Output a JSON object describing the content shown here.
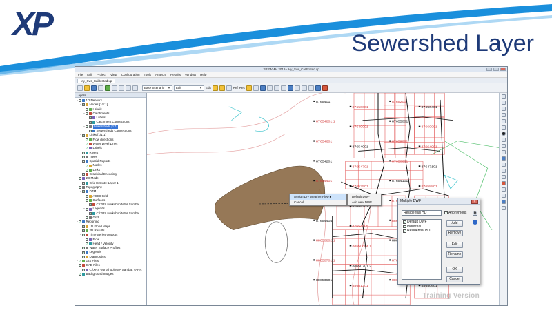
{
  "slide": {
    "logo": "XP",
    "title": "Sewershed Layer",
    "colors": {
      "brand": "#1e3a78",
      "swoosh_blue": "#1a8fdc"
    }
  },
  "window": {
    "title": "XPSWMM 2019 - My_Swr_Calibrated.xp",
    "document_tab": "My_Swr_Calibrated.xp"
  },
  "menu": [
    "File",
    "Edit",
    "Project",
    "View",
    "Configuration",
    "Tools",
    "Analyze",
    "Results",
    "Window",
    "Help"
  ],
  "toolbar": {
    "scenario_combo": "Base Scenario",
    "edit_combo": "Edit",
    "edit_label": "Edit",
    "ref_label": "Ref",
    "res_label": "Res"
  },
  "layers_panel": {
    "header": "Layers",
    "items": [
      {
        "label": "1D Network",
        "level": 0,
        "expanded": true,
        "checked": true,
        "icon": "network-icon"
      },
      {
        "label": "Nodes [1/1:1]",
        "level": 1,
        "expanded": true,
        "checked": true,
        "icon": "node-icon"
      },
      {
        "label": "Labels",
        "level": 2,
        "checked": true,
        "icon": "label-icon"
      },
      {
        "label": "Catchments",
        "level": 2,
        "expanded": true,
        "checked": true,
        "icon": "catchment-icon"
      },
      {
        "label": "Labels",
        "level": 3,
        "checked": true,
        "icon": "label-icon"
      },
      {
        "label": "Catchment Connections",
        "level": 3,
        "checked": true,
        "icon": "connection-icon"
      },
      {
        "label": "Sewersheds [1:1]",
        "level": 2,
        "expanded": true,
        "checked": true,
        "icon": "sewershed-icon",
        "selected": true
      },
      {
        "label": "Sewersheds Connections",
        "level": 3,
        "checked": true,
        "icon": "connection-icon"
      },
      {
        "label": "Links [1/1:1]",
        "level": 1,
        "expanded": true,
        "checked": true,
        "icon": "link-icon"
      },
      {
        "label": "Flow directions",
        "level": 2,
        "checked": true,
        "icon": "arrow-icon"
      },
      {
        "label": "Water Level Lines",
        "level": 2,
        "checked": true,
        "icon": "line-icon"
      },
      {
        "label": "Labels",
        "level": 2,
        "checked": true,
        "icon": "label-icon"
      },
      {
        "label": "Rivers",
        "level": 1,
        "checked": true,
        "icon": "river-icon"
      },
      {
        "label": "Trees",
        "level": 1,
        "checked": true,
        "icon": "tree-icon"
      },
      {
        "label": "Spatial Reports",
        "level": 1,
        "expanded": true,
        "checked": true,
        "icon": "report-icon"
      },
      {
        "label": "Nodes",
        "level": 2,
        "checked": true,
        "icon": "node-icon"
      },
      {
        "label": "Links",
        "level": 2,
        "checked": true,
        "icon": "link-icon"
      },
      {
        "label": "Graphical Encoding",
        "level": 1,
        "checked": true,
        "icon": "encoding-icon"
      },
      {
        "label": "2D Model",
        "level": 0,
        "expanded": true,
        "checked": true,
        "icon": "model-icon"
      },
      {
        "label": "Grid Extents: Layer 1",
        "level": 1,
        "checked": true,
        "icon": "grid-icon"
      },
      {
        "label": "Topography",
        "level": 0,
        "expanded": true,
        "checked": true,
        "icon": "topo-icon"
      },
      {
        "label": "DTM",
        "level": 1,
        "expanded": true,
        "checked": true,
        "icon": "dtm-icon"
      },
      {
        "label": "ASCII Grid",
        "level": 2,
        "checked": true,
        "icon": "grid-icon"
      },
      {
        "label": "Surfaces",
        "level": 2,
        "expanded": true,
        "checked": true,
        "icon": "surface-icon"
      },
      {
        "label": "C:\\XPS workshop\\MSA Samba\\",
        "level": 3,
        "checked": true,
        "icon": "file-icon"
      },
      {
        "label": "Legends",
        "level": 2,
        "expanded": true,
        "checked": true,
        "icon": "legend-icon"
      },
      {
        "label": "C:\\XPS workshop\\MSA Samba\\",
        "level": 3,
        "checked": true,
        "icon": "file-icon"
      },
      {
        "label": "Grid",
        "level": 2,
        "checked": true,
        "icon": "grid-icon"
      },
      {
        "label": "Reporting",
        "level": 0,
        "expanded": true,
        "checked": true,
        "icon": "report-icon"
      },
      {
        "label": "1D Flood Maps",
        "level": 1,
        "checked": true,
        "icon": "map-icon"
      },
      {
        "label": "2D Results",
        "level": 1,
        "checked": true,
        "icon": "result-icon"
      },
      {
        "label": "Time Series Outputs",
        "level": 1,
        "expanded": true,
        "checked": true,
        "icon": "timeseries-icon"
      },
      {
        "label": "Flow",
        "level": 2,
        "checked": true,
        "icon": "flow-icon"
      },
      {
        "label": "Head / Velocity",
        "level": 2,
        "checked": true,
        "icon": "velocity-icon"
      },
      {
        "label": "Water Surface Profiles",
        "level": 1,
        "checked": true,
        "icon": "profile-icon"
      },
      {
        "label": "Legends",
        "level": 1,
        "checked": true,
        "icon": "legend-icon"
      },
      {
        "label": "Diagnostics",
        "level": 1,
        "checked": true,
        "icon": "diagnostic-icon"
      },
      {
        "label": "GIS Files",
        "level": 0,
        "expanded": true,
        "checked": true,
        "icon": "gis-icon"
      },
      {
        "label": "CAD Files",
        "level": 0,
        "expanded": true,
        "checked": true,
        "icon": "cad-icon"
      },
      {
        "label": "C:\\XPS workshop\\MSA Samba\\ YARR",
        "level": 1,
        "checked": true,
        "icon": "file-icon"
      },
      {
        "label": "Background Images",
        "level": 0,
        "checked": true,
        "icon": "image-icon"
      }
    ]
  },
  "map": {
    "node_labels": [
      "8765401",
      "87650001",
      "8765200",
      "87650401",
      "87654801.1",
      "87640001",
      "87655001",
      "87660001",
      "87654601",
      "87654001",
      "87659001",
      "87664001",
      "87654201",
      "87654701",
      "87650601",
      "87647101",
      "87654401",
      "87653501",
      "87654101",
      "87658801",
      "87654103",
      "87654301",
      "87655102",
      "87651301",
      "87654404",
      "87654505",
      "88651001.1",
      "88651101",
      "88650802.1",
      "88650804.1",
      "88650801.1",
      "87650901.2",
      "88650701.1",
      "88650701.2",
      "87658701.2",
      "88653401",
      "88653601",
      "88651201",
      "88650201.1",
      "88650601"
    ]
  },
  "context_menu": {
    "items": [
      "Assign Dry Weather Flow ▸",
      "Cancel"
    ],
    "submenu": [
      "Default DWF",
      "Add new DWF..."
    ]
  },
  "dialog": {
    "title": "Multiple DWF",
    "name_value": "Residential HD",
    "anonymous_label": "Anonymous",
    "anonymous_checked": true,
    "list": [
      {
        "label": "Default DWF",
        "checked": true
      },
      {
        "label": "Industrial",
        "checked": true
      },
      {
        "label": "Residential HD",
        "checked": true
      }
    ],
    "buttons": {
      "add": "Add",
      "remove": "Remove",
      "edit": "Edit",
      "rename": "Rename",
      "ok": "OK",
      "cancel": "Cancel"
    }
  },
  "watermark": "Training Version"
}
